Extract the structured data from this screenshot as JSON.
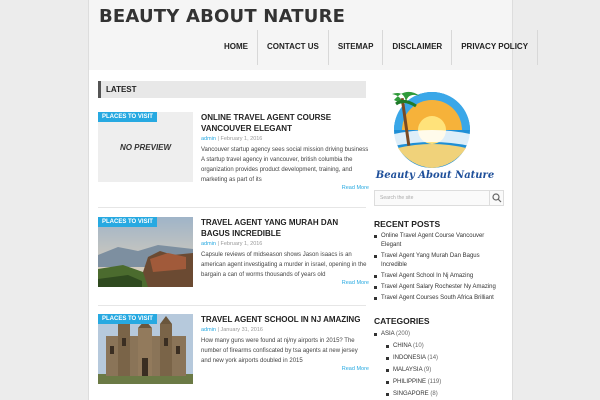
{
  "site": {
    "title": "BEAUTY ABOUT NATURE"
  },
  "nav": {
    "items": [
      "HOME",
      "CONTACT US",
      "SITEMAP",
      "DISCLAIMER",
      "PRIVACY POLICY"
    ]
  },
  "main": {
    "section_title": "LATEST",
    "posts": [
      {
        "badge": "PLACES TO VISIT",
        "thumb_text": "NO PREVIEW",
        "title": "ONLINE TRAVEL AGENT COURSE VANCOUVER ELEGANT",
        "author": "admin",
        "sep": "|",
        "date": "February 1, 2016",
        "excerpt": "Vancouver startup agency sees social mission driving business A startup travel agency in vancouver, british columbia the organization provides product development, training, and marketing as part of its",
        "read_more": "Read More"
      },
      {
        "badge": "PLACES TO VISIT",
        "title": "TRAVEL AGENT YANG MURAH DAN BAGUS INCREDIBLE",
        "author": "admin",
        "sep": "|",
        "date": "February 1, 2016",
        "excerpt": "Capsule reviews of midseason shows Jason isaacs is an american agent investigating a murder in israel, opening in the bargain a can of worms thousands of years old",
        "read_more": "Read More"
      },
      {
        "badge": "PLACES TO VISIT",
        "title": "TRAVEL AGENT SCHOOL IN NJ AMAZING",
        "author": "admin",
        "sep": "|",
        "date": "January 31, 2016",
        "excerpt": "How many guns were found at nj/ny airports in 2015? The number of firearms confiscated by tsa agents at new jersey and new york airports doubled in 2015",
        "read_more": "Read More"
      }
    ]
  },
  "sidebar": {
    "logo_text": "Beauty About Nature",
    "search_placeholder": "Search the site",
    "recent_title": "RECENT POSTS",
    "recent_posts": [
      "Online Travel Agent Course Vancouver Elegant",
      "Travel Agent Yang Murah Dan Bagus Incredible",
      "Travel Agent School In Nj Amazing",
      "Travel Agent Salary Rochester Ny Amazing",
      "Travel Agent Courses South Africa Brilliant"
    ],
    "categories_title": "CATEGORIES",
    "categories": {
      "name": "ASIA",
      "count": "(200)"
    },
    "subcategories": [
      {
        "name": "CHINA",
        "count": "(10)"
      },
      {
        "name": "INDONESIA",
        "count": "(14)"
      },
      {
        "name": "MALAYSIA",
        "count": "(9)"
      },
      {
        "name": "PHILIPPINE",
        "count": "(119)"
      },
      {
        "name": "SINGAPORE",
        "count": "(8)"
      }
    ]
  },
  "colors": {
    "accent": "#27a9e1",
    "background": "#ececec"
  }
}
